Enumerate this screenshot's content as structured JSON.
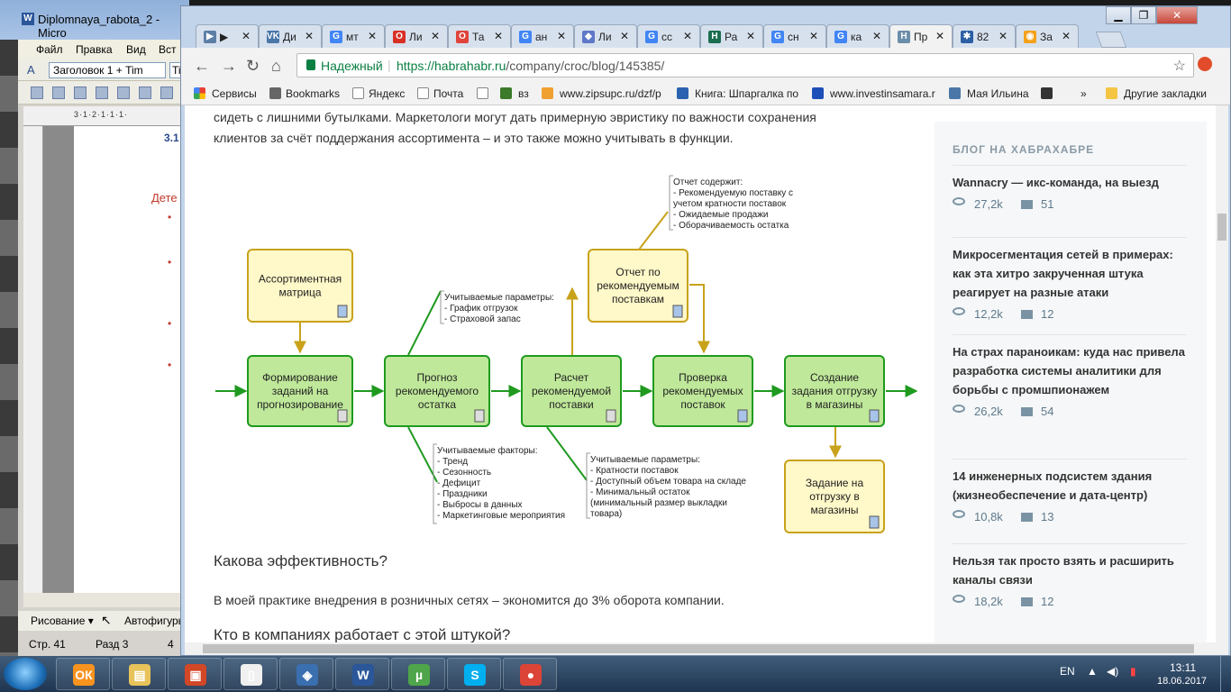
{
  "word": {
    "title": "Diplomnaya_rabota_2 - Micro",
    "menu": [
      "Файл",
      "Правка",
      "Вид",
      "Вст"
    ],
    "style_box": "Заголовок 1 + Tim",
    "font_box": "Tim",
    "ruler": "3·1·2·1·1·1·",
    "heading": "3.1",
    "doc_text": "Дете",
    "draw_label": "Рисование ▾",
    "autoshapes": "Автофигуры",
    "status_page": "Стр. 41",
    "status_section": "Разд 3",
    "status_num": "4"
  },
  "chrome": {
    "tabs": [
      {
        "icon": "▶",
        "color": "#5b7ea6",
        "label": "▶",
        "active": false
      },
      {
        "icon": "VK",
        "color": "#4a76a8",
        "label": "Ди",
        "active": false
      },
      {
        "icon": "G",
        "color": "#4285f4",
        "label": "мт",
        "active": false
      },
      {
        "icon": "O",
        "color": "#d93025",
        "label": "Ли",
        "active": false
      },
      {
        "icon": "O",
        "color": "#e0443a",
        "label": "Та",
        "active": false
      },
      {
        "icon": "G",
        "color": "#4285f4",
        "label": "ан",
        "active": false
      },
      {
        "icon": "◆",
        "color": "#5f78c8",
        "label": "Ли",
        "active": false
      },
      {
        "icon": "G",
        "color": "#4285f4",
        "label": "сс",
        "active": false
      },
      {
        "icon": "H",
        "color": "#1b6e4f",
        "label": "Ра",
        "active": false
      },
      {
        "icon": "G",
        "color": "#4285f4",
        "label": "сн",
        "active": false
      },
      {
        "icon": "G",
        "color": "#4285f4",
        "label": "ка",
        "active": false
      },
      {
        "icon": "H",
        "color": "#6b8eaa",
        "label": "Пр",
        "active": true
      },
      {
        "icon": "✱",
        "color": "#2c5fa3",
        "label": "82",
        "active": false
      },
      {
        "icon": "◉",
        "color": "#f4a11b",
        "label": "За",
        "active": false
      }
    ],
    "secure": "Надежный",
    "url_host": "https://habrahabr.ru",
    "url_path": "/company/croc/blog/145385/",
    "bookmarks": [
      "Сервисы",
      "Bookmarks",
      "Яндекс",
      "Почта",
      "вз",
      "www.zipsupc.ru/dzf/p",
      "Книга: Шпаргалка по",
      "www.investinsamara.r",
      "Мая Ильина",
      "»",
      "Другие закладки"
    ]
  },
  "article": {
    "p1a": "сидеть с лишними бутылками. Маркетологи могут дать примерную эвристику по важности сохранения",
    "p1b": "клиентов за счёт поддержания ассортимента – и это также можно учитывать в функции.",
    "h2": "Какова эффективность?",
    "p2": "В моей практике внедрения в розничных сетях – экономится до 3% оборота компании.",
    "h3": "Кто в компаниях работает с этой штукой?"
  },
  "diagram": {
    "matrix": [
      "Ассортиментная",
      "матрица"
    ],
    "b1": [
      "Формирование",
      "заданий на",
      "прогнозирование"
    ],
    "b2": [
      "Прогноз",
      "рекомендуемого",
      "остатка"
    ],
    "b3": [
      "Расчет",
      "рекомендуемой",
      "поставки"
    ],
    "b4": [
      "Проверка",
      "рекомендуемых",
      "поставок"
    ],
    "b5": [
      "Создание",
      "задания отгрузку",
      "в магазины"
    ],
    "report": [
      "Отчет по",
      "рекомендуемым",
      "поставкам"
    ],
    "task": [
      "Задание на",
      "отгрузку в",
      "магазины"
    ],
    "note_report": [
      "Отчет содержит:",
      "- Рекомендуемую поставку с",
      "учетом кратности поставок",
      "- Ожидаемые продажи",
      "- Оборачиваемость остатка"
    ],
    "note_params1": [
      "Учитываемые параметры:",
      "- График отгрузок",
      "- Страховой запас"
    ],
    "note_factors": [
      "Учитываемые факторы:",
      "- Тренд",
      "- Сезонность",
      "- Дефицит",
      "- Праздники",
      "- Выбросы в данных",
      "- Маркетинговые мероприятия"
    ],
    "note_params2": [
      "Учитываемые параметры:",
      "- Кратности поставок",
      "- Доступный объем товара на складе",
      "- Минимальный остаток",
      "(минимальный размер выкладки",
      "товара)"
    ]
  },
  "sidebar": {
    "heading": "БЛОГ НА ХАБРАХАБРЕ",
    "posts": [
      {
        "title": "Wannacry — икс-команда, на выезд",
        "views": "27,2k",
        "comments": "51"
      },
      {
        "title": "Микросегментация сетей в примерах: как эта хитро закрученная штука реагирует на разные атаки",
        "views": "12,2k",
        "comments": "12"
      },
      {
        "title": "На страх параноикам: куда нас привела разработка системы аналитики для борьбы с промшпионажем",
        "views": "26,2k",
        "comments": "54"
      },
      {
        "title": "14 инженерных подсистем здания (жизнеобеспечение и дата-центр)",
        "views": "10,8k",
        "comments": "13"
      },
      {
        "title": "Нельзя так просто взять и расширить каналы связи",
        "views": "18,2k",
        "comments": "12"
      }
    ]
  },
  "taskbar": {
    "apps": [
      {
        "name": "odnoklassniki",
        "glyph": "ОК",
        "color": "#f7931e"
      },
      {
        "name": "explorer",
        "glyph": "▤",
        "color": "#e7c35a"
      },
      {
        "name": "powerpoint",
        "glyph": "▣",
        "color": "#d24726"
      },
      {
        "name": "document",
        "glyph": "▯",
        "color": "#f0f0f0"
      },
      {
        "name": "game",
        "glyph": "◈",
        "color": "#3a6fb0"
      },
      {
        "name": "word",
        "glyph": "W",
        "color": "#2b579a"
      },
      {
        "name": "utorrent",
        "glyph": "µ",
        "color": "#4ea54a"
      },
      {
        "name": "skype",
        "glyph": "S",
        "color": "#00aff0"
      },
      {
        "name": "chrome",
        "glyph": "●",
        "color": "#db4437"
      }
    ],
    "lang": "EN",
    "time": "13:11",
    "date": "18.06.2017"
  }
}
